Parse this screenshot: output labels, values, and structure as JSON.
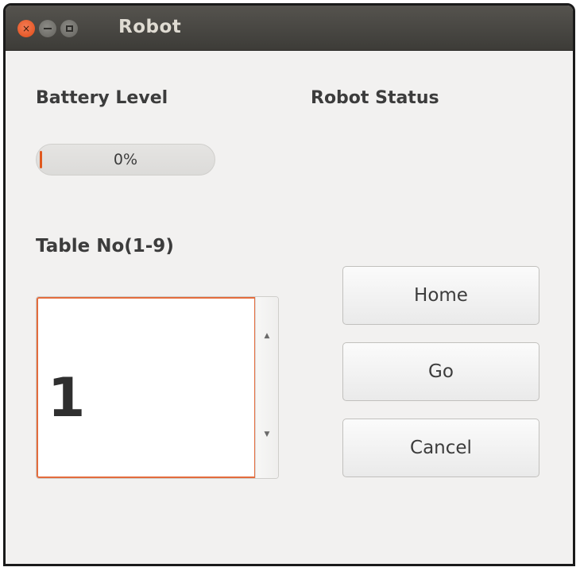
{
  "window": {
    "title": "Robot",
    "controls": {
      "close_glyph": "×",
      "close_icon": "close-icon",
      "minimize_icon": "minimize-icon",
      "maximize_icon": "maximize-icon"
    }
  },
  "battery": {
    "label": "Battery Level",
    "value_text": "0%",
    "level_percent": 0,
    "fill_color": "#e0581e"
  },
  "status": {
    "label": "Robot Status"
  },
  "table": {
    "label": "Table No(1-9)",
    "value": "1",
    "up_glyph": "▲",
    "down_glyph": "▼",
    "focus_color": "#e36c3d"
  },
  "buttons": {
    "home": "Home",
    "go": "Go",
    "cancel": "Cancel"
  },
  "colors": {
    "titlebar": "#3d3c38",
    "window_bg": "#f2f1f0",
    "accent": "#df4b16"
  }
}
